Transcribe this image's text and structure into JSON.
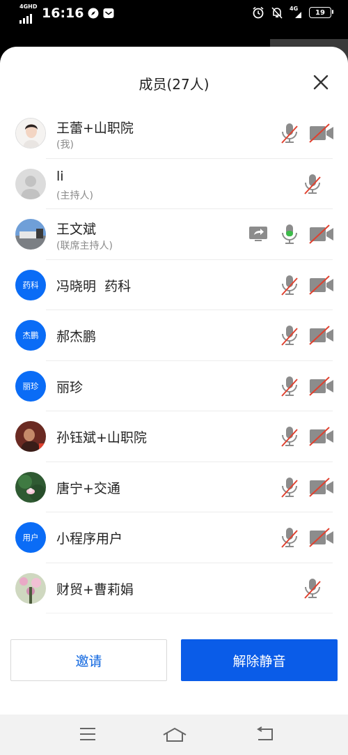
{
  "status_bar": {
    "network_label": "4GHD",
    "time": "16:16",
    "network_right": "4G",
    "battery": "19"
  },
  "sheet": {
    "title": "成员(27人)"
  },
  "members": [
    {
      "name": "王蕾+山职院",
      "role": "(我)",
      "avatar": "photo",
      "mic": "muted",
      "camera": "off"
    },
    {
      "name": "li",
      "role": "(主持人)",
      "avatar": "default",
      "mic": "muted",
      "camera": "none"
    },
    {
      "name": "王文斌",
      "role": "(联席主持人)",
      "avatar": "photo",
      "mic": "active",
      "camera": "off",
      "sharing": true
    },
    {
      "name": "冯晓明  药科",
      "role": "",
      "avatar_text": "药科",
      "mic": "muted",
      "camera": "off"
    },
    {
      "name": "郝杰鹏",
      "role": "",
      "avatar_text": "杰鹏",
      "mic": "muted",
      "camera": "off"
    },
    {
      "name": "丽珍",
      "role": "",
      "avatar_text": "丽珍",
      "mic": "muted",
      "camera": "off"
    },
    {
      "name": "孙钰斌+山职院",
      "role": "",
      "avatar": "photo",
      "mic": "muted",
      "camera": "off"
    },
    {
      "name": "唐宁+交通",
      "role": "",
      "avatar": "photo",
      "mic": "muted",
      "camera": "off"
    },
    {
      "name": "小程序用户",
      "role": "",
      "avatar_text": "用户",
      "mic": "muted",
      "camera": "off"
    },
    {
      "name": "财贸+曹莉娟",
      "role": "",
      "avatar": "photo",
      "mic": "muted",
      "camera": "none"
    }
  ],
  "footer": {
    "invite_label": "邀请",
    "unmute_label": "解除静音"
  },
  "colors": {
    "accent": "#0a5ce8",
    "avatar_blue": "#0a6cf6",
    "mute_slash": "#e0412f",
    "mic_active": "#3dbb4a",
    "icon_gray": "#8c8c8c"
  },
  "icons": [
    "signal-icon",
    "compass-icon",
    "message-icon",
    "alarm-icon",
    "bell-off-icon",
    "battery-icon",
    "close-icon",
    "mic-muted-icon",
    "mic-active-icon",
    "camera-off-icon",
    "screen-share-icon",
    "menu-icon",
    "home-icon",
    "back-icon"
  ]
}
